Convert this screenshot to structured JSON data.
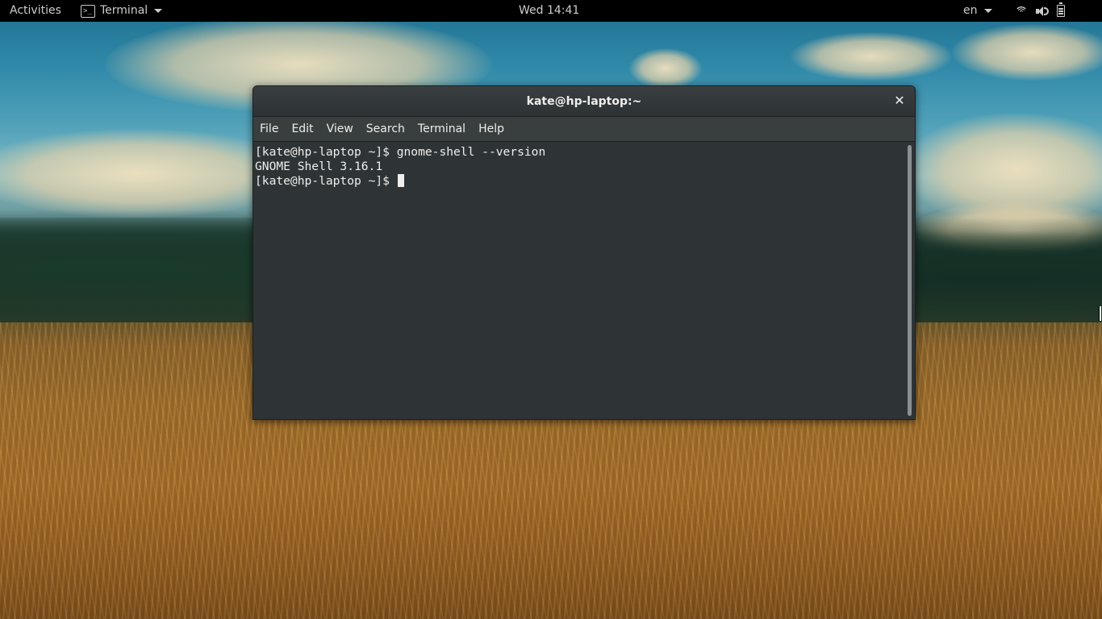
{
  "top_panel": {
    "activities_label": "Activities",
    "app_menu_label": "Terminal",
    "clock": "Wed 14:41",
    "language": "en",
    "status_icons": [
      "wifi-icon",
      "volume-icon",
      "battery-icon"
    ]
  },
  "terminal": {
    "window_title": "kate@hp-laptop:~",
    "close_glyph": "✕",
    "menu": [
      "File",
      "Edit",
      "View",
      "Search",
      "Terminal",
      "Help"
    ],
    "lines": [
      "[kate@hp-laptop ~]$ gnome-shell --version",
      "GNOME Shell 3.16.1",
      "[kate@hp-laptop ~]$ "
    ]
  },
  "colors": {
    "panel_bg": "#000000",
    "terminal_bg": "#2e3436",
    "terminal_fg": "#eeeeec",
    "titlebar_bg": "#353a3c"
  }
}
